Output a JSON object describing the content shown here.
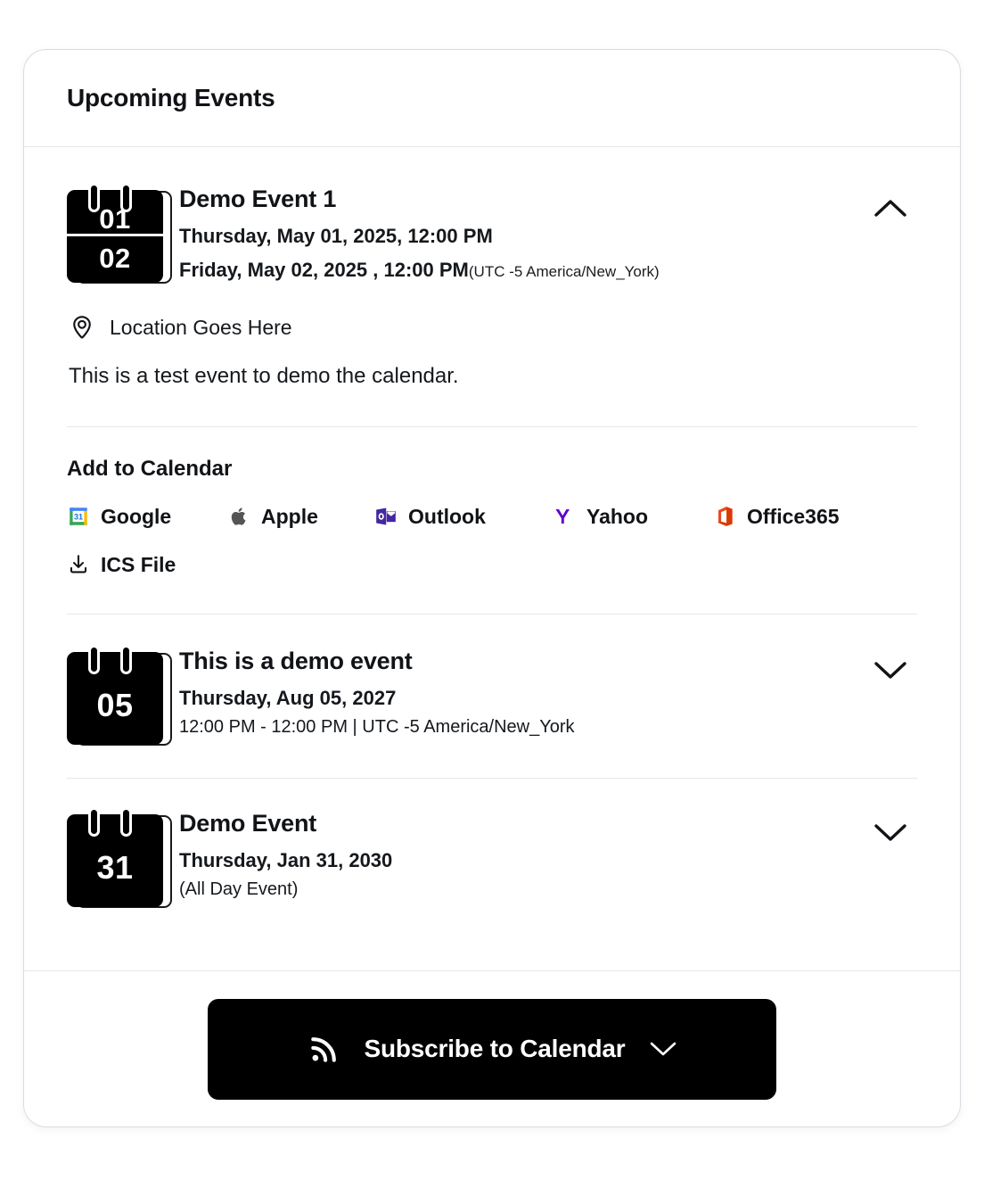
{
  "card": {
    "title": "Upcoming Events"
  },
  "events": [
    {
      "id": "demo-event-1",
      "title": "Demo Event 1",
      "day_badge_top": "01",
      "day_badge_bottom": "02",
      "date_line_1": "Thursday, May 01, 2025, 12:00 PM",
      "date_line_2": "Friday, May 02, 2025 , 12:00 PM",
      "timezone_note": "(UTC -5 America/New_York)",
      "expanded": true,
      "toggle_icon": "chevron-up-icon",
      "location": "Location Goes Here",
      "description": "This is a test event to demo the calendar.",
      "add_to_calendar": {
        "heading": "Add to Calendar",
        "options": [
          {
            "label": "Google",
            "icon": "google-calendar-icon"
          },
          {
            "label": "Apple",
            "icon": "apple-icon"
          },
          {
            "label": "Outlook",
            "icon": "outlook-icon"
          },
          {
            "label": "Yahoo",
            "icon": "yahoo-icon"
          },
          {
            "label": "Office365",
            "icon": "office365-icon"
          },
          {
            "label": "ICS File",
            "icon": "download-icon"
          }
        ]
      }
    },
    {
      "id": "demo-event-2",
      "title": "This is a demo event",
      "day_badge": "05",
      "date_line_1": "Thursday, Aug 05, 2027",
      "date_line_2": "12:00 PM - 12:00 PM | UTC -5 America/New_York",
      "expanded": false,
      "toggle_icon": "chevron-down-icon"
    },
    {
      "id": "demo-event-3",
      "title": "Demo Event",
      "day_badge": "31",
      "date_line_1": "Thursday, Jan 31, 2030",
      "date_line_2": "(All Day Event)",
      "expanded": false,
      "toggle_icon": "chevron-down-icon"
    }
  ],
  "footer": {
    "subscribe_label": "Subscribe to Calendar",
    "rss_icon": "rss-icon",
    "chevron_icon": "chevron-down-icon"
  },
  "colors": {
    "accent": "#000000",
    "card_border": "#d8dde2",
    "divider": "#e4e8ec",
    "text": "#111317",
    "google_blue": "#1a73e8",
    "google_yellow": "#fbbc04",
    "google_green": "#34a853",
    "apple_gray": "#555555",
    "outlook_purple": "#4527a0",
    "yahoo_purple": "#5f01d1",
    "office_orange": "#d83b01"
  }
}
